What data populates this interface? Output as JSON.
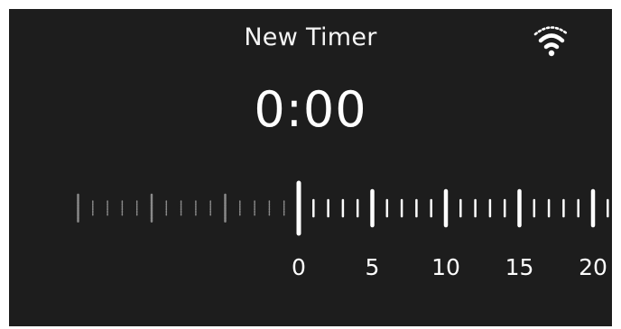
{
  "title": "New Timer",
  "time_display": "0:00",
  "status_icon": "wifi-connecting-icon",
  "dial": {
    "current_value": 0,
    "min_visible": -15,
    "max_visible": 21,
    "labels": [
      "0",
      "5",
      "10",
      "15",
      "20"
    ]
  },
  "colors": {
    "background": "#1d1d1d",
    "text": "#ffffff",
    "inactive_tick": "#8a8a8a"
  }
}
